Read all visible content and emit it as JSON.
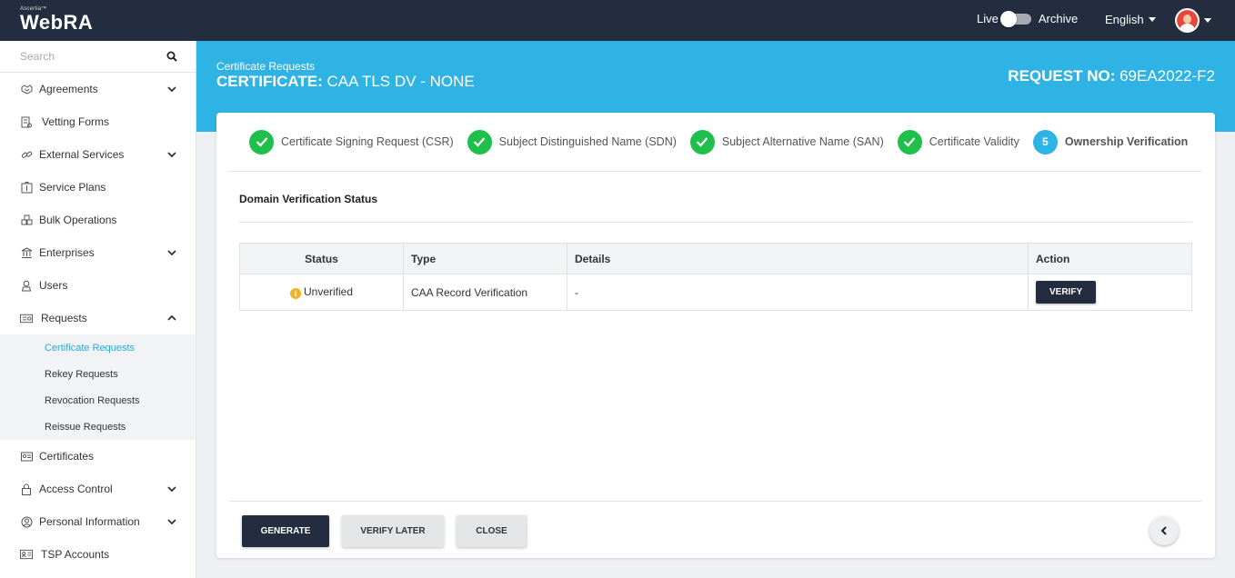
{
  "app": {
    "brand_small": "Ascertia™",
    "brand": "WebRA"
  },
  "topbar": {
    "live_label": "Live",
    "archive_label": "Archive",
    "language": "English",
    "avatar_icon": "user-avatar-icon"
  },
  "sidebar": {
    "search_placeholder": "Search",
    "items": [
      {
        "label": "Agreements",
        "icon": "handshake-icon",
        "chevron": "down"
      },
      {
        "label": "Vetting Forms",
        "icon": "form-icon",
        "chevron": ""
      },
      {
        "label": "External Services",
        "icon": "link-icon",
        "chevron": "down"
      },
      {
        "label": "Service Plans",
        "icon": "plan-icon",
        "chevron": ""
      },
      {
        "label": "Bulk Operations",
        "icon": "bulk-icon",
        "chevron": ""
      },
      {
        "label": "Enterprises",
        "icon": "bank-icon",
        "chevron": "down"
      },
      {
        "label": "Users",
        "icon": "user-icon",
        "chevron": ""
      },
      {
        "label": "Requests",
        "icon": "requests-icon",
        "chevron": "up"
      }
    ],
    "subitems": [
      {
        "label": "Certificate Requests",
        "active": true
      },
      {
        "label": "Rekey Requests",
        "active": false
      },
      {
        "label": "Revocation Requests",
        "active": false
      },
      {
        "label": "Reissue Requests",
        "active": false
      }
    ],
    "items_after": [
      {
        "label": "Certificates",
        "icon": "certificate-icon",
        "chevron": ""
      },
      {
        "label": "Access Control",
        "icon": "lock-icon",
        "chevron": "down"
      },
      {
        "label": "Personal Information",
        "icon": "person-circle-icon",
        "chevron": "down"
      },
      {
        "label": "TSP Accounts",
        "icon": "account-card-icon",
        "chevron": ""
      }
    ]
  },
  "header": {
    "breadcrumb": "Certificate Requests",
    "cert_prefix": "CERTIFICATE:",
    "cert_name": "CAA TLS DV - NONE",
    "request_prefix": "REQUEST NO:",
    "request_no": "69EA2022-F2"
  },
  "steps": [
    {
      "label": "Certificate Signing Request (CSR)",
      "status": "done"
    },
    {
      "label": "Subject Distinguished Name (SDN)",
      "status": "done"
    },
    {
      "label": "Subject Alternative Name (SAN)",
      "status": "done"
    },
    {
      "label": "Certificate Validity",
      "status": "done"
    },
    {
      "label": "Ownership Verification",
      "status": "current",
      "number": "5"
    }
  ],
  "section": {
    "title": "Domain Verification Status"
  },
  "table": {
    "headers": [
      "Status",
      "Type",
      "Details",
      "Action"
    ],
    "rows": [
      {
        "status": "Unverified",
        "type": "CAA Record Verification",
        "details": "-",
        "action": "VERIFY"
      }
    ]
  },
  "footer": {
    "generate": "GENERATE",
    "verify_later": "VERIFY LATER",
    "close": "CLOSE"
  },
  "colors": {
    "topbar": "#232d3f",
    "accent": "#2fb3e4",
    "success": "#1fbf4c",
    "warning": "#f0b323"
  }
}
